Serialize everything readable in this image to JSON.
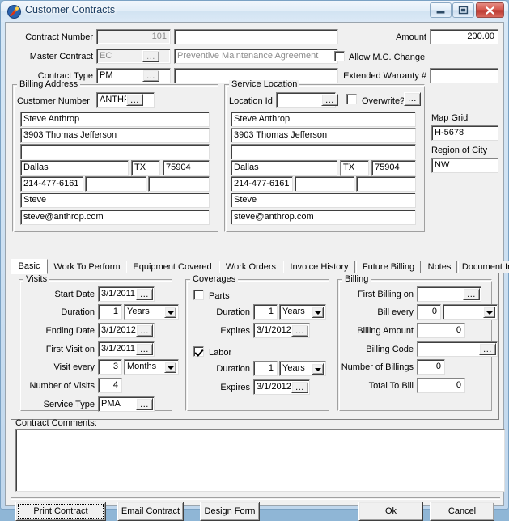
{
  "window": {
    "title": "Customer Contracts",
    "icon": "app-comet-icon",
    "buttons": {
      "minimize": "minimize-icon",
      "maximize": "maximize-icon",
      "close": "close-icon"
    }
  },
  "header": {
    "contract_number": {
      "label": "Contract Number",
      "value": "101",
      "readonly": true
    },
    "contract_description": {
      "value": ""
    },
    "master_contract": {
      "label": "Master Contract",
      "value": "EC",
      "readonly": true
    },
    "master_contract_description": {
      "value": "Preventive Maintenance Agreement"
    },
    "contract_type": {
      "label": "Contract Type",
      "value": "PM"
    },
    "contract_type_description": {
      "value": ""
    },
    "amount": {
      "label": "Amount",
      "value": "200.00"
    },
    "allow_mc_change": {
      "label": "Allow M.C. Change",
      "checked": false
    },
    "extended_warranty": {
      "label": "Extended Warranty #",
      "value": ""
    },
    "ellipsis": "..."
  },
  "billing_address": {
    "caption": "Billing Address",
    "customer_number_label": "Customer Number",
    "customer_number": "ANTHRO",
    "name": "Steve Anthrop",
    "address1": "3903 Thomas Jefferson",
    "address2": "",
    "city": "Dallas",
    "state": "TX",
    "zip": "75904",
    "phone1": "214-477-6161",
    "phone2": "",
    "phone3": "",
    "contact": "Steve",
    "email": "steve@anthrop.com"
  },
  "service_location": {
    "caption": "Service Location",
    "location_id_label": "Location Id",
    "location_id": "",
    "overwrite_label": "Overwrite?",
    "overwrite_checked": false,
    "name": "Steve Anthrop",
    "address1": "3903 Thomas Jefferson",
    "address2": "",
    "city": "Dallas",
    "state": "TX",
    "zip": "75904",
    "phone1": "214-477-6161",
    "phone2": "",
    "phone3": "",
    "contact": "Steve",
    "email": "steve@anthrop.com"
  },
  "map": {
    "map_grid_label": "Map Grid",
    "map_grid": "H-5678",
    "region_label": "Region of City",
    "region": "NW"
  },
  "tabs": [
    {
      "label": "Basic",
      "selected": true
    },
    {
      "label": "Work To Perform",
      "selected": false
    },
    {
      "label": "Equipment Covered",
      "selected": false
    },
    {
      "label": "Work Orders",
      "selected": false
    },
    {
      "label": "Invoice History",
      "selected": false
    },
    {
      "label": "Future Billing",
      "selected": false
    },
    {
      "label": "Notes",
      "selected": false
    },
    {
      "label": "Document Images",
      "selected": false
    }
  ],
  "visits": {
    "caption": "Visits",
    "start_date_label": "Start Date",
    "start_date": "3/1/2011",
    "duration_label": "Duration",
    "duration_value": "1",
    "duration_unit": "Years",
    "ending_date_label": "Ending Date",
    "ending_date": "3/1/2012",
    "first_visit_label": "First Visit on",
    "first_visit": "3/1/2011",
    "visit_every_label": "Visit every",
    "visit_every_value": "3",
    "visit_every_unit": "Months",
    "number_of_visits_label": "Number of Visits",
    "number_of_visits": "4",
    "service_type_label": "Service Type",
    "service_type": "PMA"
  },
  "coverages": {
    "caption": "Coverages",
    "parts_label": "Parts",
    "parts_checked": false,
    "parts_duration_label": "Duration",
    "parts_duration_value": "1",
    "parts_duration_unit": "Years",
    "parts_expires_label": "Expires",
    "parts_expires": "3/1/2012",
    "labor_label": "Labor",
    "labor_checked": true,
    "labor_duration_label": "Duration",
    "labor_duration_value": "1",
    "labor_duration_unit": "Years",
    "labor_expires_label": "Expires",
    "labor_expires": "3/1/2012"
  },
  "billing": {
    "caption": "Billing",
    "first_billing_label": "First Billing on",
    "first_billing": "",
    "bill_every_label": "Bill every",
    "bill_every_value": "0",
    "bill_every_unit": "",
    "billing_amount_label": "Billing Amount",
    "billing_amount": "0",
    "billing_code_label": "Billing Code",
    "billing_code": "",
    "number_of_billings_label": "Number of Billings",
    "number_of_billings": "0",
    "total_to_bill_label": "Total To Bill",
    "total_to_bill": "0"
  },
  "comments": {
    "label": "Contract Comments:",
    "value": ""
  },
  "footer": {
    "print": {
      "pre": "",
      "acc": "P",
      "post": "rint Contract",
      "focused": true
    },
    "email": {
      "pre": "",
      "acc": "E",
      "post": "mail Contract"
    },
    "design": {
      "pre": "",
      "acc": "D",
      "post": "esign Form"
    },
    "ok": {
      "pre": "",
      "acc": "O",
      "post": "k"
    },
    "cancel": {
      "pre": "",
      "acc": "C",
      "post": "ancel"
    }
  },
  "colors": {
    "face": "#f0f0f0",
    "field": "#ffffff",
    "readonly_text": "#8b8b8b",
    "title_text": "#1b3e63",
    "close_red": "#c8453c"
  }
}
